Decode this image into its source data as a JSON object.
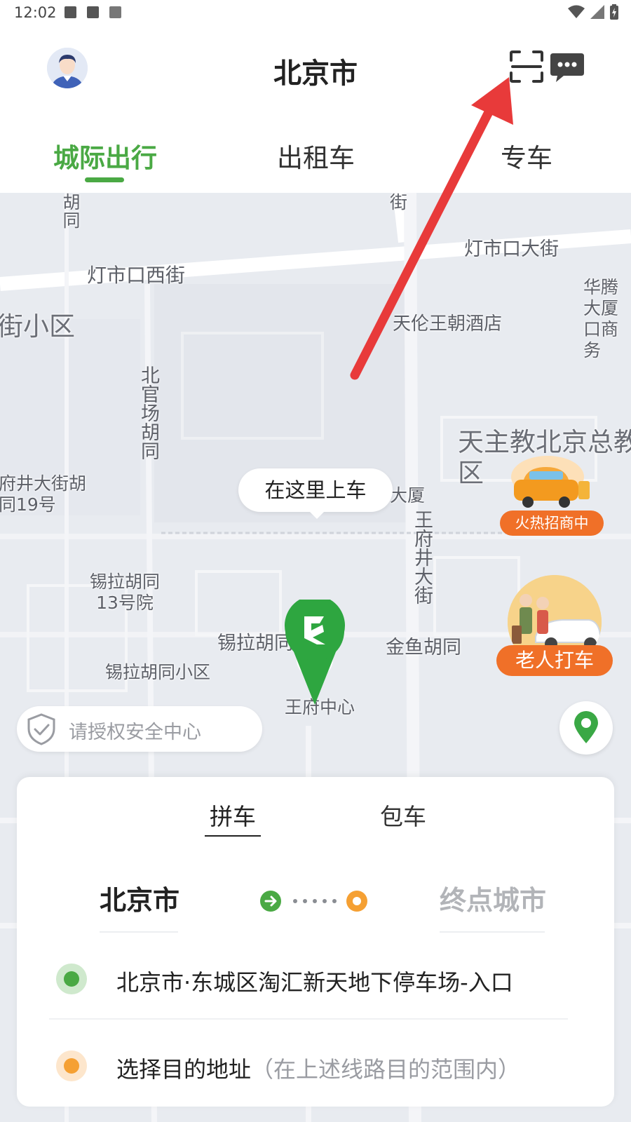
{
  "status_bar": {
    "time": "12:02"
  },
  "header": {
    "city": "北京市"
  },
  "tabs": [
    {
      "label": "城际出行",
      "active": true
    },
    {
      "label": "出租车",
      "active": false
    },
    {
      "label": "专车",
      "active": false
    }
  ],
  "map": {
    "labels": {
      "hutong_top": "胡同",
      "jie_top": "街",
      "dengshikou_xijie": "灯市口西街",
      "dengshikou_dajie": "灯市口大街",
      "jie_xiaoqu": "街小区",
      "tianlun_hotel": "天伦王朝酒店",
      "huateng": "华腾大厦口商务",
      "bei_guanchang_hutong": "北官场胡同",
      "catholic": "天主教北京总教区",
      "wangfujing_street_hutong": "府井大街胡同19号",
      "dasha": "大厦",
      "wangfujing_dajie": "王府井大街",
      "xila_hutong_13": "锡拉胡同13号院",
      "xila_hutong": "锡拉胡同",
      "jinyu_hutong": "金鱼胡同",
      "xila_xiaoqu": "锡拉胡同小区",
      "wangfu_center": "王府中心"
    },
    "pickup_bubble": "在这里上车",
    "promo_hot": "火热招商中",
    "promo_elderly": "老人打车",
    "security_label": "请授权安全中心"
  },
  "card": {
    "subtabs": [
      {
        "label": "拼车",
        "active": true
      },
      {
        "label": "包车",
        "active": false
      }
    ],
    "from_city": "北京市",
    "to_city": "终点城市",
    "start_address": "北京市·东城区淘汇新天地下停车场-入口",
    "dest_label": "选择目的地址",
    "dest_hint": "（在上述线路目的范围内）"
  },
  "colors": {
    "brand_green": "#4aa944",
    "accent_orange": "#f07028",
    "arrow_red": "#e83a3a"
  }
}
